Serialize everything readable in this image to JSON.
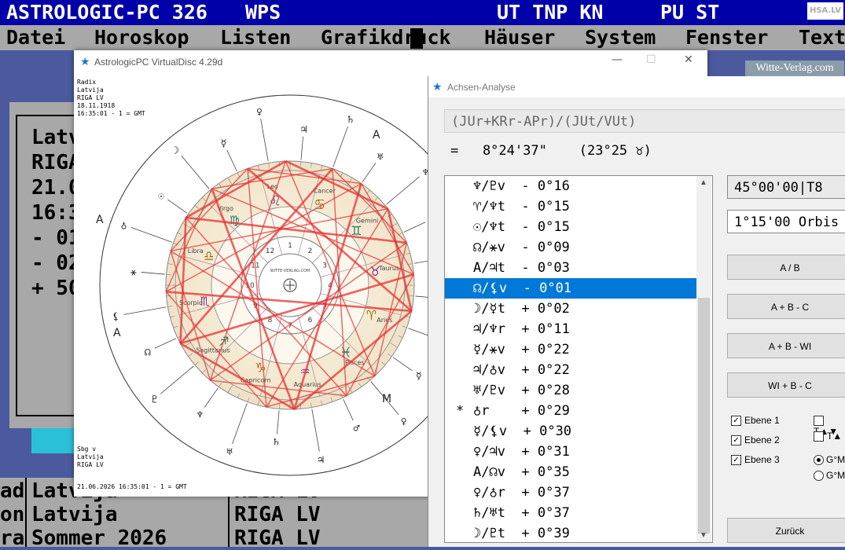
{
  "app": {
    "title_left": "ASTROLOGIC-PC 326",
    "title_mode": "WPS",
    "title_status": "UT TNP KN",
    "title_status2": "PU ST",
    "badge": "HSA.LV"
  },
  "menu": [
    "Datei",
    "Horoskop",
    "Listen",
    "Grafikdruck",
    "Häuser",
    "System",
    "Fenster",
    "Text"
  ],
  "dos_card": {
    "lines": [
      "Latv",
      "RIGA",
      "21.0",
      "16:3",
      "- 01",
      "- 02",
      "+ 50"
    ]
  },
  "dos_bottom": {
    "col1": [
      "ad",
      "on",
      "ra"
    ],
    "col2": [
      "Latvija",
      "Latvija",
      "Sommer 2026"
    ],
    "col3": [
      "RIGA  LV",
      "RIGA  LV",
      "RIGA  LV"
    ]
  },
  "chart_window": {
    "title": "AstrologicPC VirtualDisc 4.29d",
    "controls": [
      "—",
      "☐",
      "✕"
    ],
    "info_top": [
      "Radix",
      "Latvija",
      "RIGA  LV",
      "18.11.1918",
      "16:35:01 - 1 = GMT"
    ],
    "info_bottom": [
      "Sbg v",
      "Latvija",
      "RIGA  LV"
    ],
    "footer": "21.06.2026 16:35:01 - 1 = GMT",
    "publisher": "Witte-Verlag.com",
    "signs": [
      "Leo",
      "Virgo",
      "Libra",
      "Scorpio",
      "Sagittarius",
      "Capricorn",
      "Aquarius",
      "Pisces",
      "Aries",
      "Taurus",
      "Gemini",
      "Cancer"
    ],
    "outer_letters": [
      "A",
      "M",
      "A",
      "A",
      "M"
    ],
    "center_text": "WITTE-VERLAG.COM"
  },
  "analysis": {
    "title": "Achsen-Analyse",
    "formula": "(JUr+KRr-APr)/(JUt/VUt)",
    "result": "=   8°24'37\"    (23°25 ♉)",
    "rows": [
      {
        "mark": "",
        "text": "♆/♇v  - 0°16"
      },
      {
        "mark": "",
        "text": "♈/♆t  - 0°15"
      },
      {
        "mark": "",
        "text": "☉/♆t  - 0°15"
      },
      {
        "mark": "",
        "text": "☊/⚹v  - 0°09"
      },
      {
        "mark": "",
        "text": "A/♃t  - 0°03"
      },
      {
        "mark": "",
        "text": "☊/⚸v  - 0°01"
      },
      {
        "mark": "",
        "text": "☽/☿t  + 0°02"
      },
      {
        "mark": "",
        "text": "♃/♆r  + 0°11"
      },
      {
        "mark": "",
        "text": "☿/⚹v  + 0°22"
      },
      {
        "mark": "",
        "text": "♃/♁v  + 0°22"
      },
      {
        "mark": "",
        "text": "♅/♇v  + 0°28"
      },
      {
        "mark": "*",
        "text": "♁r    + 0°29"
      },
      {
        "mark": "",
        "text": "☿/⚸v  + 0°30"
      },
      {
        "mark": "",
        "text": "♀/♃v  + 0°31"
      },
      {
        "mark": "",
        "text": "A/☊v  + 0°35"
      },
      {
        "mark": "",
        "text": "♀/♁r  + 0°37"
      },
      {
        "mark": "",
        "text": "♄/♅t  + 0°37"
      },
      {
        "mark": "",
        "text": "☽/♇t  + 0°39"
      }
    ],
    "selected_index": 5,
    "field_angle": "45°00'00|T8",
    "field_orbis": "1°15'00 Orbis",
    "buttons": [
      "A / B",
      "A + B - C",
      "A + B - WI",
      "WI + B - C"
    ],
    "back_button": "Zurück",
    "checks": [
      {
        "label": "Ebene 1",
        "checked": true
      },
      {
        "label": "Ebene 2",
        "checked": true
      },
      {
        "label": "Ebene 3",
        "checked": true
      }
    ],
    "checks_right": [
      {
        "label": "T▲▼",
        "checked": false
      },
      {
        "label": "T▲",
        "checked": false
      }
    ],
    "radios": [
      {
        "label": "G°M",
        "on": true
      },
      {
        "label": "G°M",
        "on": false
      }
    ]
  }
}
